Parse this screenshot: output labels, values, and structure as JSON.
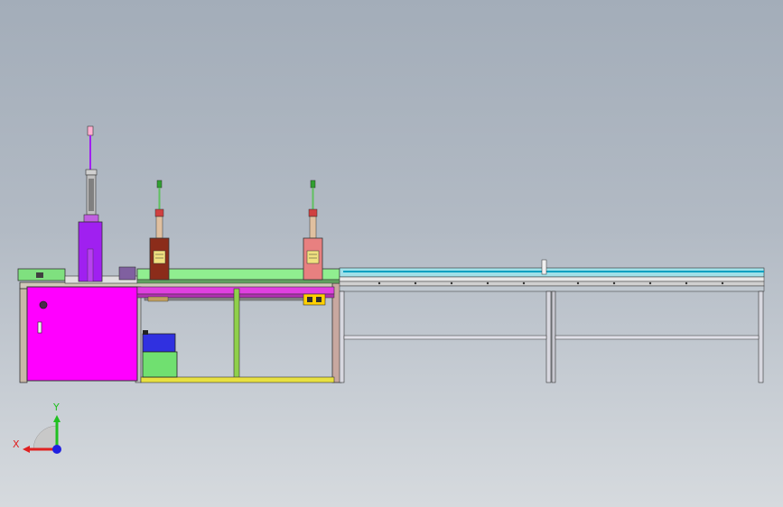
{
  "colors": {
    "background_top": "#a3adb9",
    "background_bottom": "#d6dade",
    "cabinet": "#ff00ff",
    "slide_table": "#90ee90",
    "cylinder_purple": "#a020f0",
    "conveyor_cyan": "#00bcd4",
    "frame_gray": "#c8c8c8",
    "blue_block": "#3030e0",
    "axis_x": "#e02020",
    "axis_y": "#20c020",
    "axis_z": "#2020e0"
  },
  "triad": {
    "x_label": "X",
    "y_label": "Y"
  }
}
